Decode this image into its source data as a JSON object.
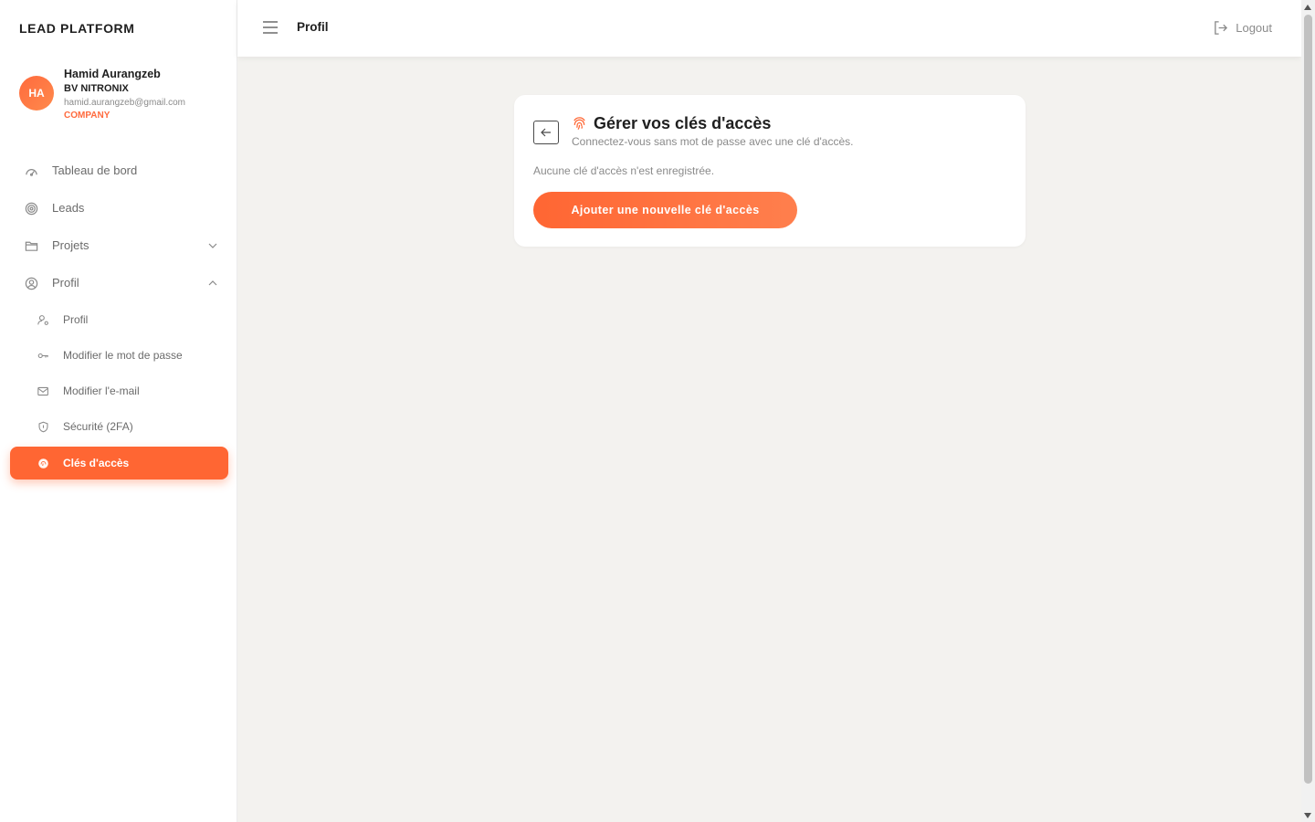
{
  "brand": "LEAD PLATFORM",
  "user": {
    "initials": "HA",
    "name": "Hamid Aurangzeb",
    "company": "BV NITRONIX",
    "email": "hamid.aurangzeb@gmail.com",
    "role": "COMPANY"
  },
  "nav": {
    "dashboard": "Tableau de bord",
    "leads": "Leads",
    "projects": "Projets",
    "profile": "Profil",
    "sub": {
      "profile": "Profil",
      "password": "Modifier le mot de passe",
      "email": "Modifier l'e-mail",
      "security": "Sécurité (2FA)",
      "passkeys": "Clés d'accès"
    }
  },
  "topbar": {
    "title": "Profil",
    "logout": "Logout"
  },
  "card": {
    "title": "Gérer vos clés d'accès",
    "subtitle": "Connectez-vous sans mot de passe avec une clé d'accès.",
    "empty": "Aucune clé d'accès n'est enregistrée.",
    "add_button": "Ajouter une nouvelle clé d'accès"
  },
  "colors": {
    "accent": "#ff6633",
    "background": "#f3f2ef",
    "muted": "#8a8a8a"
  },
  "icons": {
    "menu": "hamburger-icon",
    "logout": "logout-icon",
    "back": "arrow-left-icon",
    "passkey": "fingerprint-icon"
  }
}
